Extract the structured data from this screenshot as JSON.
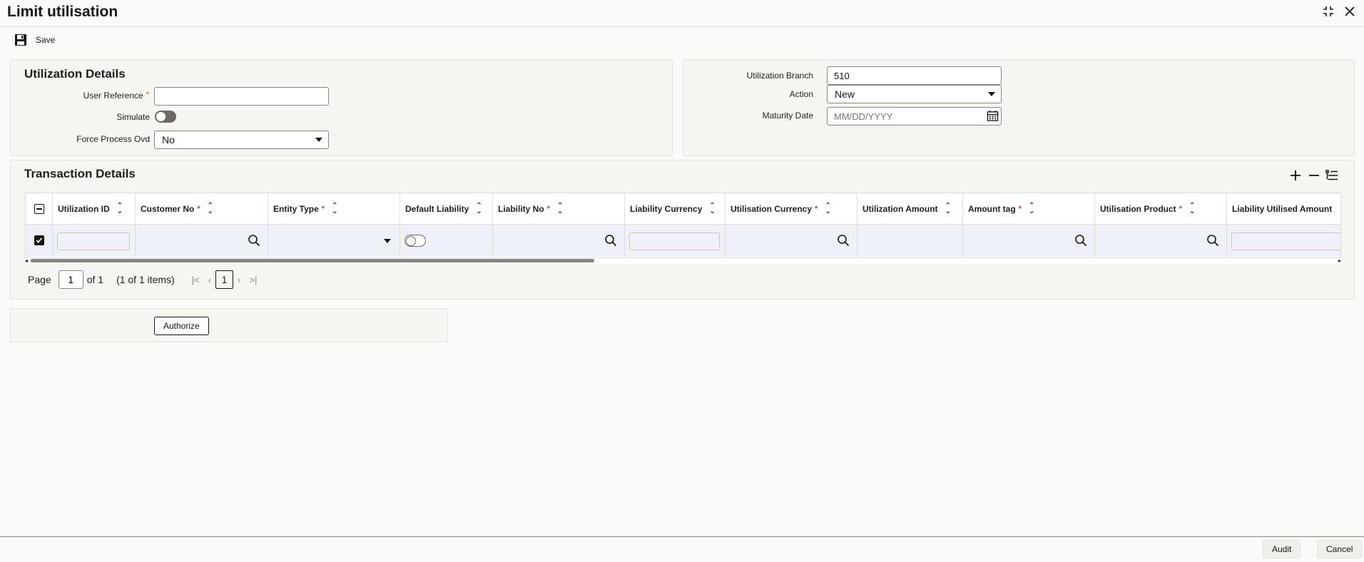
{
  "window": {
    "title": "Limit utilisation"
  },
  "toolbar": {
    "save_label": "Save"
  },
  "utilization_details": {
    "title": "Utilization Details",
    "user_reference": {
      "label": "User Reference",
      "value": ""
    },
    "simulate": {
      "label": "Simulate",
      "on": false
    },
    "force_process_ovd": {
      "label": "Force Process Ovd",
      "value": "No"
    }
  },
  "branch_panel": {
    "utilization_branch": {
      "label": "Utilization Branch",
      "value": "510"
    },
    "action": {
      "label": "Action",
      "value": "New"
    },
    "maturity_date": {
      "label": "Maturity Date",
      "value": "",
      "placeholder": "MM/DD/YYYY"
    }
  },
  "transaction_details": {
    "title": "Transaction Details",
    "columns": [
      {
        "label": "Utilization ID",
        "required": false
      },
      {
        "label": "Customer No",
        "required": true
      },
      {
        "label": "Entity Type",
        "required": true
      },
      {
        "label": "Default Liability",
        "required": false
      },
      {
        "label": "Liability No",
        "required": true
      },
      {
        "label": "Liability Currency",
        "required": false
      },
      {
        "label": "Utilisation Currency",
        "required": true
      },
      {
        "label": "Utilization Amount",
        "required": false
      },
      {
        "label": "Amount tag",
        "required": true
      },
      {
        "label": "Utilisation Product",
        "required": true
      },
      {
        "label": "Liability Utilised Amount",
        "required": false
      }
    ],
    "required_marker": "*",
    "pager": {
      "page_label": "Page",
      "page_value": "1",
      "of_label": "of 1",
      "items_label": "(1 of 1 items)",
      "current_page": "1"
    }
  },
  "actions": {
    "authorize_label": "Authorize"
  },
  "footer": {
    "audit_label": "Audit",
    "cancel_label": "Cancel"
  }
}
